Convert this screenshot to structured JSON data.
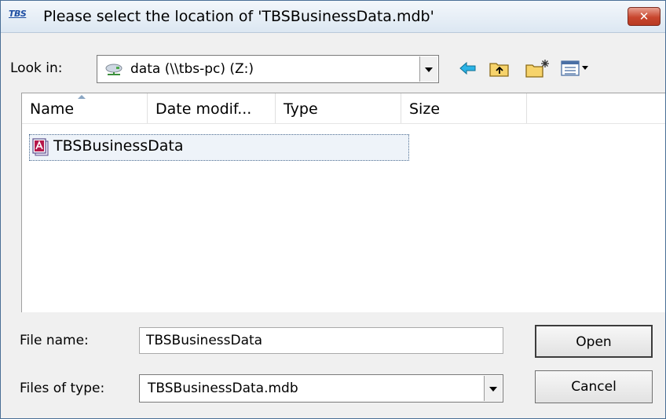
{
  "window": {
    "title": "Please select the location of 'TBSBusinessData.mdb'",
    "app_logo_text": "TBS",
    "close_label": "✕"
  },
  "lookin": {
    "label": "Look in:",
    "value": "data (\\\\tbs-pc) (Z:)"
  },
  "toolbar": {
    "icons": [
      "back-arrow-icon",
      "up-folder-icon",
      "new-folder-icon",
      "view-menu-icon"
    ]
  },
  "list": {
    "columns": [
      "Name",
      "Date modif...",
      "Type",
      "Size"
    ],
    "sort_column": "Name",
    "items": [
      {
        "name": "TBSBusinessData",
        "icon": "access-database-icon",
        "selected": true
      }
    ]
  },
  "filename": {
    "label": "File name:",
    "value": "TBSBusinessData"
  },
  "filetype": {
    "label": "Files of type:",
    "value": "TBSBusinessData.mdb"
  },
  "buttons": {
    "open": "Open",
    "cancel": "Cancel"
  },
  "colors": {
    "title_bar": "#dce7f2",
    "close_button": "#c8462e",
    "selection_border": "#4d6d91",
    "dialog_background": "#f0f0f0",
    "back_arrow": "#2bb3e6"
  }
}
